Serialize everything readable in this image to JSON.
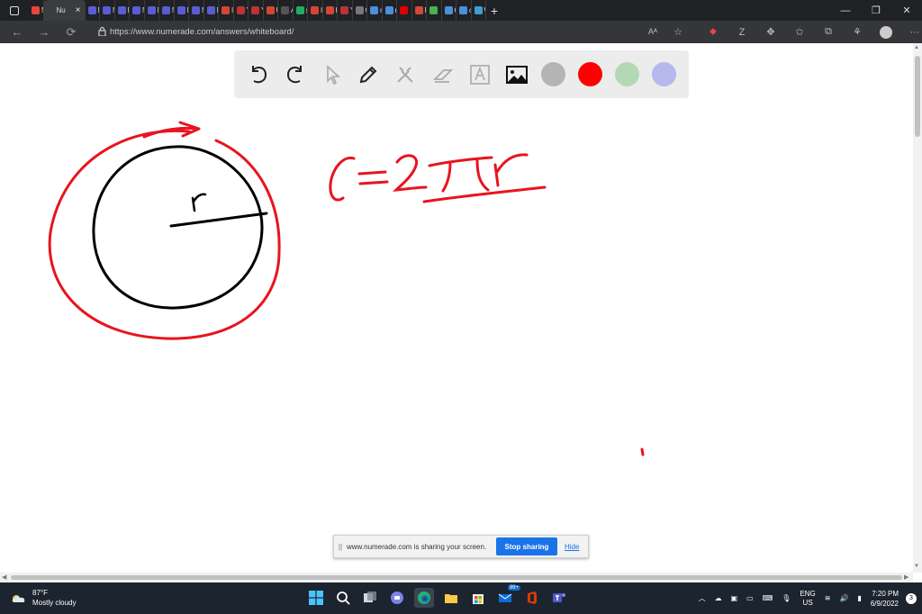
{
  "browser": {
    "tabs": [
      {
        "label": "Nu",
        "color": "#e8453c",
        "active": false
      },
      {
        "label": "Nu",
        "color": "#3b3c3f",
        "active": true
      },
      {
        "label": "Nu",
        "color": "#5b5bd6",
        "active": false
      },
      {
        "label": "Nu",
        "color": "#5b5bd6",
        "active": false
      },
      {
        "label": "Nu",
        "color": "#5b5bd6",
        "active": false
      },
      {
        "label": "Nu",
        "color": "#5b5bd6",
        "active": false
      },
      {
        "label": "Nu",
        "color": "#5b5bd6",
        "active": false
      },
      {
        "label": "Nu",
        "color": "#5b5bd6",
        "active": false
      },
      {
        "label": "Nu",
        "color": "#5b5bd6",
        "active": false
      },
      {
        "label": "Nu",
        "color": "#5b5bd6",
        "active": false
      },
      {
        "label": "Nu",
        "color": "#5b5bd6",
        "active": false
      },
      {
        "label": "In",
        "color": "#d44638",
        "active": false
      },
      {
        "label": "Ya",
        "color": "#b33",
        "active": false
      },
      {
        "label": "Ya",
        "color": "#b33",
        "active": false
      },
      {
        "label": "Up",
        "color": "#d44638",
        "active": false
      },
      {
        "label": "A",
        "color": "#555",
        "active": false
      },
      {
        "label": "st",
        "color": "#2a6",
        "active": false
      },
      {
        "label": "In",
        "color": "#d44638",
        "active": false
      },
      {
        "label": "In",
        "color": "#d44638",
        "active": false
      },
      {
        "label": "Ya",
        "color": "#b33",
        "active": false
      },
      {
        "label": "G",
        "color": "#777",
        "active": false
      },
      {
        "label": "nc",
        "color": "#4a90d9",
        "active": false
      },
      {
        "label": "m",
        "color": "#4a90d9",
        "active": false
      },
      {
        "label": "",
        "color": "#d00",
        "active": false
      },
      {
        "label": "M",
        "color": "#d44638",
        "active": false
      },
      {
        "label": "",
        "color": "#4caf50",
        "active": false
      },
      {
        "label": "Q",
        "color": "#4a90d9",
        "active": false
      },
      {
        "label": "ch",
        "color": "#4a90d9",
        "active": false
      },
      {
        "label": "W",
        "color": "#3aa0d0",
        "active": false
      }
    ],
    "new_tab_label": "+",
    "window_controls": [
      "—",
      "❐",
      "✕"
    ],
    "url": "https://www.numerade.com/answers/whiteboard/",
    "read_aloud": "Aᴬ"
  },
  "whiteboard": {
    "tools": [
      {
        "name": "undo-tool"
      },
      {
        "name": "redo-tool"
      },
      {
        "name": "select-tool"
      },
      {
        "name": "pen-tool"
      },
      {
        "name": "tools-tool"
      },
      {
        "name": "eraser-tool"
      },
      {
        "name": "text-tool"
      },
      {
        "name": "image-tool"
      }
    ],
    "colors": [
      {
        "name": "color-gray",
        "hex": "#b4b4b4"
      },
      {
        "name": "color-red",
        "hex": "#ff0000"
      },
      {
        "name": "color-green",
        "hex": "#b4d8b4"
      },
      {
        "name": "color-purple",
        "hex": "#b4b8ec"
      }
    ],
    "ink_colors": {
      "black": "#000000",
      "red": "#e8141e"
    }
  },
  "share_banner": {
    "grip": "||",
    "message": "www.numerade.com is sharing your screen.",
    "stop_label": "Stop sharing",
    "hide_label": "Hide"
  },
  "taskbar": {
    "weather_temp": "87°F",
    "weather_desc": "Mostly cloudy",
    "lang_top": "ENG",
    "lang_bottom": "US",
    "time": "7:20 PM",
    "date": "6/9/2022",
    "notifications": "3",
    "store_badge": "99+"
  }
}
